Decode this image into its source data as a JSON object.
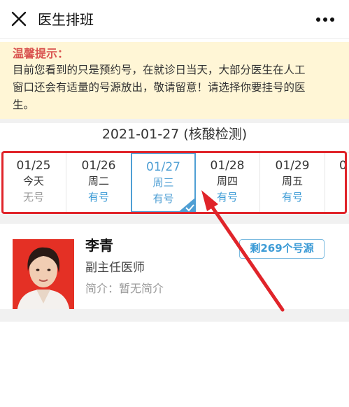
{
  "nav": {
    "title": "医生排班",
    "close_icon": "close-icon",
    "more_icon": "more-icon"
  },
  "notice": {
    "title": "温馨提示：",
    "line1": "目前您看到的只是预约号，在就诊日当天，大部分医生在人工",
    "line2": "窗口还会有适量的号源放出，敬请留意！请选择你要挂号的医",
    "line3": "生。"
  },
  "date_header": "2021-01-27 (核酸检测)",
  "days": [
    {
      "date": "01/25",
      "week": "今天",
      "status": "无号"
    },
    {
      "date": "01/26",
      "week": "周二",
      "status": "有号"
    },
    {
      "date": "01/27",
      "week": "周三",
      "status": "有号",
      "selected": true
    },
    {
      "date": "01/28",
      "week": "周四",
      "status": "有号"
    },
    {
      "date": "01/29",
      "week": "周五",
      "status": "有号"
    },
    {
      "date": "0",
      "week": "",
      "status": ""
    }
  ],
  "doctor": {
    "name": "李青",
    "title": "副主任医师",
    "intro": "简介：暂无简介",
    "remaining": "剩269个号源"
  },
  "colors": {
    "accent": "#3c9bd6",
    "highlight": "#e0242a",
    "notice_bg": "#fff6d6",
    "warning": "#d9534f"
  }
}
